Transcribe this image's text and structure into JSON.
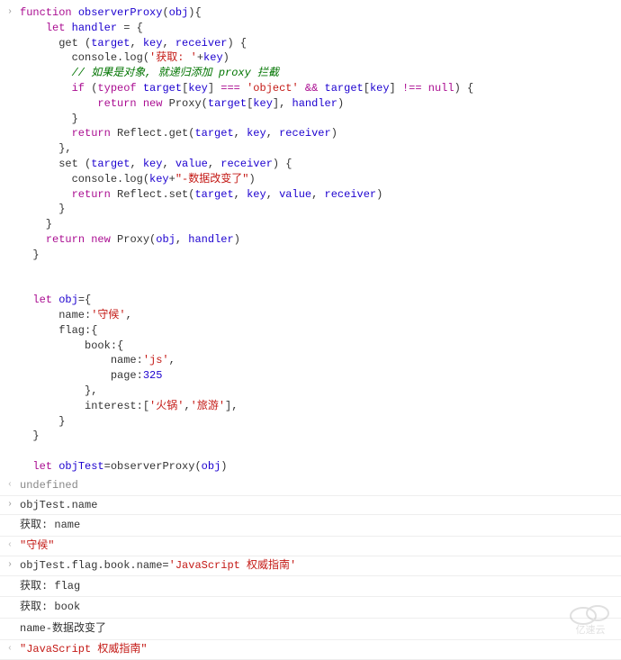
{
  "code_block_1": {
    "l1": "function observerProxy(obj){",
    "l2": "    let handler = {",
    "l3": "      get (target, key, receiver) {",
    "l4": "        console.log('获取: '+key)",
    "l5": "        // 如果是对象, 就递归添加 proxy 拦截",
    "l6": "        if (typeof target[key] === 'object' && target[key] !== null) {",
    "l7": "            return new Proxy(target[key], handler)",
    "l8": "        }",
    "l9": "        return Reflect.get(target, key, receiver)",
    "l10": "      },",
    "l11": "      set (target, key, value, receiver) {",
    "l12": "        console.log(key+\"-数据改变了\")",
    "l13": "        return Reflect.set(target, key, value, receiver)",
    "l14": "      }",
    "l15": "    }",
    "l16": "    return new Proxy(obj, handler)",
    "l17": "  }"
  },
  "code_block_2": {
    "l1": "  let obj={",
    "l2": "      name:'守候',",
    "l3": "      flag:{",
    "l4": "          book:{",
    "l5": "              name:'js',",
    "l6": "              page:325",
    "l7": "          },",
    "l8": "          interest:['火锅','旅游'],",
    "l9": "      }",
    "l10": "  }"
  },
  "code_block_3": "  let objTest=observerProxy(obj)",
  "result_1": "undefined",
  "input_2": "objTest.name",
  "log_2a": "获取: name",
  "result_2": "\"守候\"",
  "input_3": "objTest.flag.book.name='JavaScript 权威指南'",
  "log_3a": "获取: flag",
  "log_3b": "获取: book",
  "log_3c": "name-数据改变了",
  "result_3": "\"JavaScript 权威指南\"",
  "watermark": "亿速云"
}
